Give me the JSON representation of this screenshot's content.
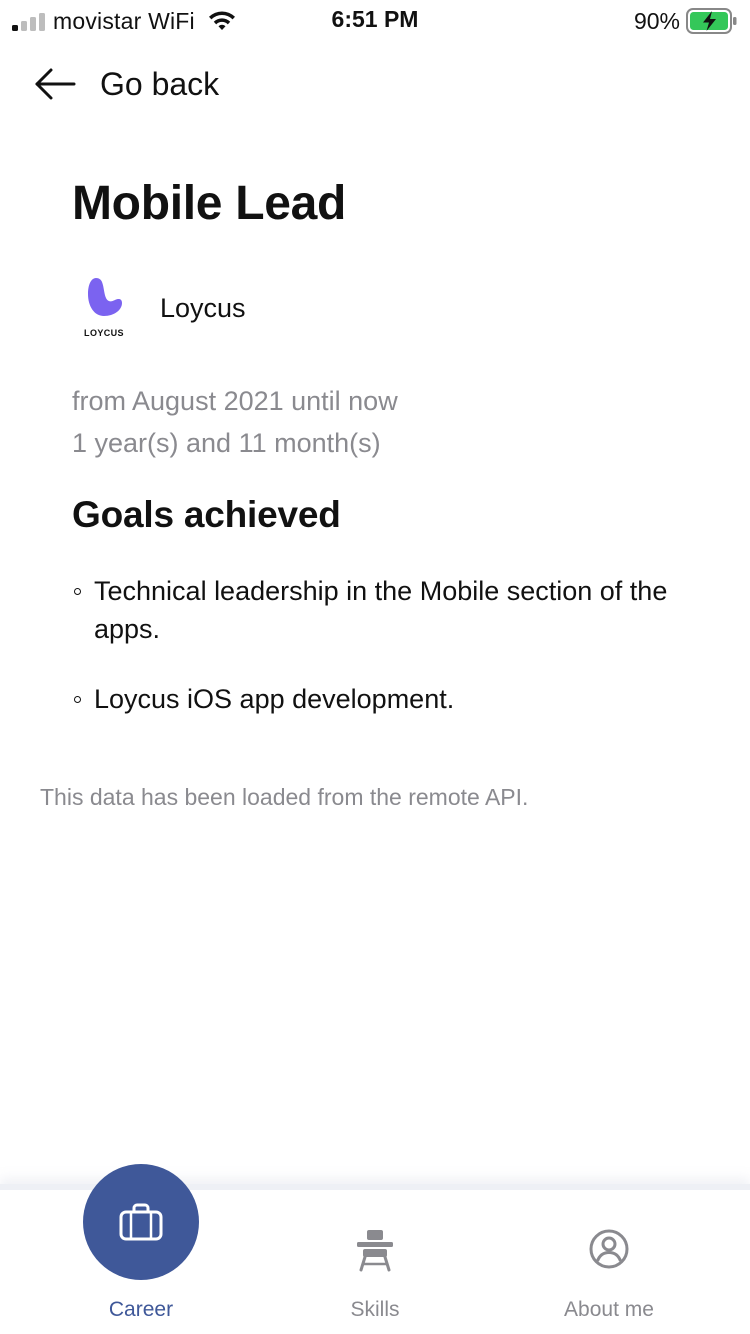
{
  "status_bar": {
    "carrier": "movistar WiFi",
    "time": "6:51 PM",
    "battery": "90%"
  },
  "header": {
    "back_label": "Go back"
  },
  "job": {
    "title": "Mobile Lead",
    "company": "Loycus",
    "logo_text": "LOYCUS",
    "period": "from August 2021 until now",
    "duration": "1 year(s) and 11 month(s)"
  },
  "goals": {
    "heading": "Goals achieved",
    "items": [
      "Technical leadership in the Mobile section of the apps.",
      "Loycus iOS app development."
    ]
  },
  "api_note": "This data has been loaded from the remote API.",
  "tabbar": {
    "tabs": [
      {
        "label": "Career",
        "icon": "briefcase-icon",
        "active": true
      },
      {
        "label": "Skills",
        "icon": "desk-icon",
        "active": false
      },
      {
        "label": "About me",
        "icon": "user-circle-icon",
        "active": false
      }
    ]
  },
  "colors": {
    "accent": "#3f5899",
    "logo_purple": "#7b63f0",
    "secondary_text": "#8a8a8f",
    "battery_green": "#34c759"
  }
}
